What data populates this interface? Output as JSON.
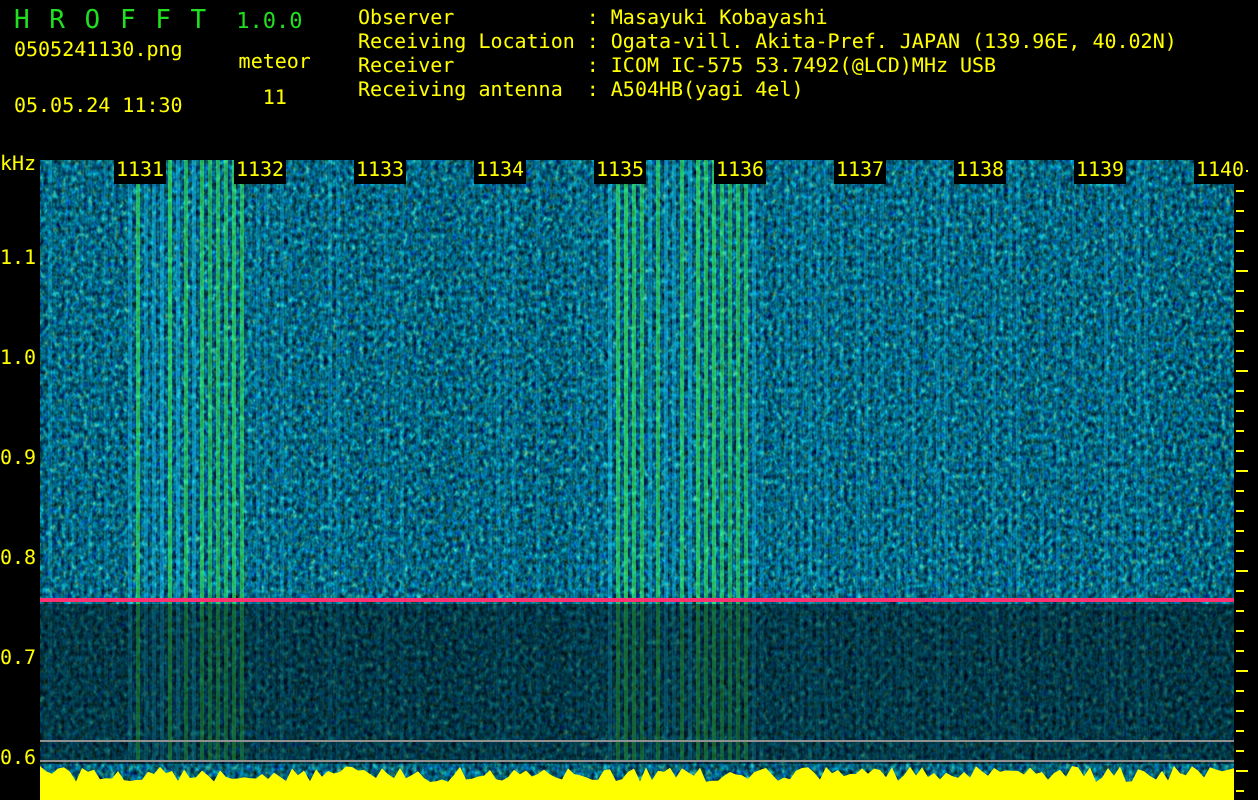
{
  "app": {
    "title": "H R O F F T",
    "version": "1.0.0"
  },
  "file": {
    "name": "0505241130.png",
    "datetime": "05.05.24 11:30"
  },
  "meteor": {
    "label": "meteor",
    "count": "11"
  },
  "info": [
    {
      "label": "Observer",
      "separator": ":",
      "value": "Masayuki Kobayashi"
    },
    {
      "label": "Receiving Location",
      "separator": ":",
      "value": "Ogata-vill. Akita-Pref. JAPAN (139.96E, 40.02N)"
    },
    {
      "label": "Receiver",
      "separator": ":",
      "value": "ICOM IC-575 53.7492(@LCD)MHz USB"
    },
    {
      "label": "Receiving antenna",
      "separator": ":",
      "value": "A504HB(yagi 4el)"
    }
  ],
  "spectrogram": {
    "unit": "kHz",
    "y_labels": [
      "1.1",
      "1.0",
      "0.9",
      "0.8",
      "0.7",
      "0.6"
    ],
    "time_labels": [
      "1131",
      "1132",
      "1133",
      "1134",
      "1135",
      "1136",
      "1137",
      "1138",
      "1139",
      "1140"
    ]
  }
}
